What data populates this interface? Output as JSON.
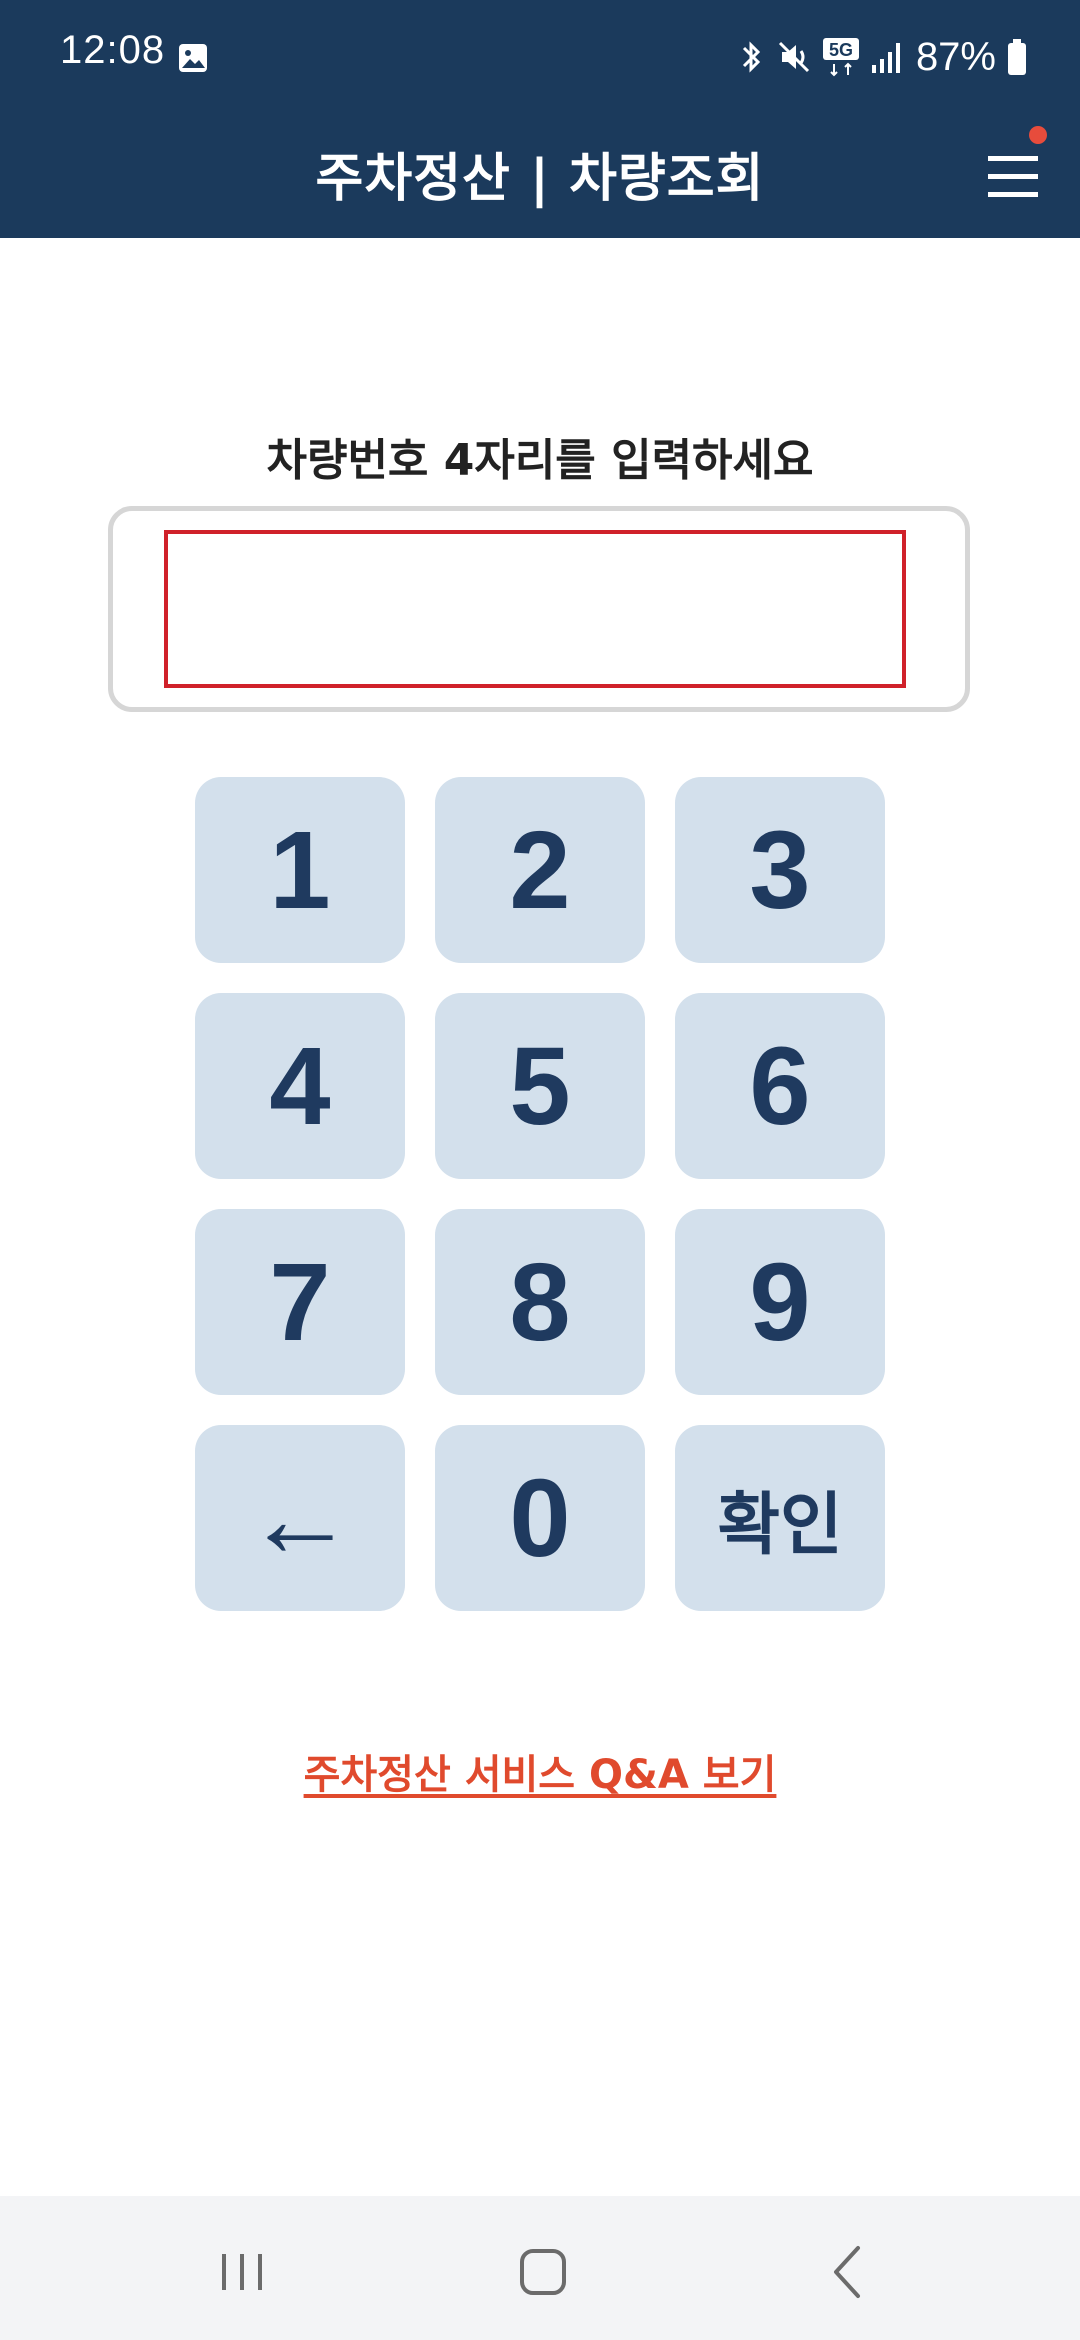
{
  "status_bar": {
    "time": "12:08",
    "battery": "87%",
    "network": "5G",
    "icons": [
      "gallery-icon",
      "bluetooth-icon",
      "mute-icon",
      "5g-icon",
      "signal-icon",
      "battery-icon"
    ]
  },
  "header": {
    "title": "주차정산 | 차량조회",
    "menu_icon": "hamburger-menu-icon"
  },
  "prompt": "차량번호 4자리를 입력하세요",
  "input": {
    "value": ""
  },
  "keypad": {
    "keys": [
      {
        "label": "1"
      },
      {
        "label": "2"
      },
      {
        "label": "3"
      },
      {
        "label": "4"
      },
      {
        "label": "5"
      },
      {
        "label": "6"
      },
      {
        "label": "7"
      },
      {
        "label": "8"
      },
      {
        "label": "9"
      },
      {
        "label": "←"
      },
      {
        "label": "0"
      },
      {
        "label": "확인"
      }
    ]
  },
  "qa_link": "주차정산 서비스 Q&A 보기",
  "colors": {
    "header_bg": "#1b3a5c",
    "key_bg": "#d3e0ec",
    "key_text": "#1f3a5f",
    "input_border": "#d0212a",
    "link": "#e04a2d",
    "notification_dot": "#e74c3c"
  },
  "nav_bar": {
    "icons": [
      "recent-apps-icon",
      "home-icon",
      "back-icon"
    ]
  }
}
